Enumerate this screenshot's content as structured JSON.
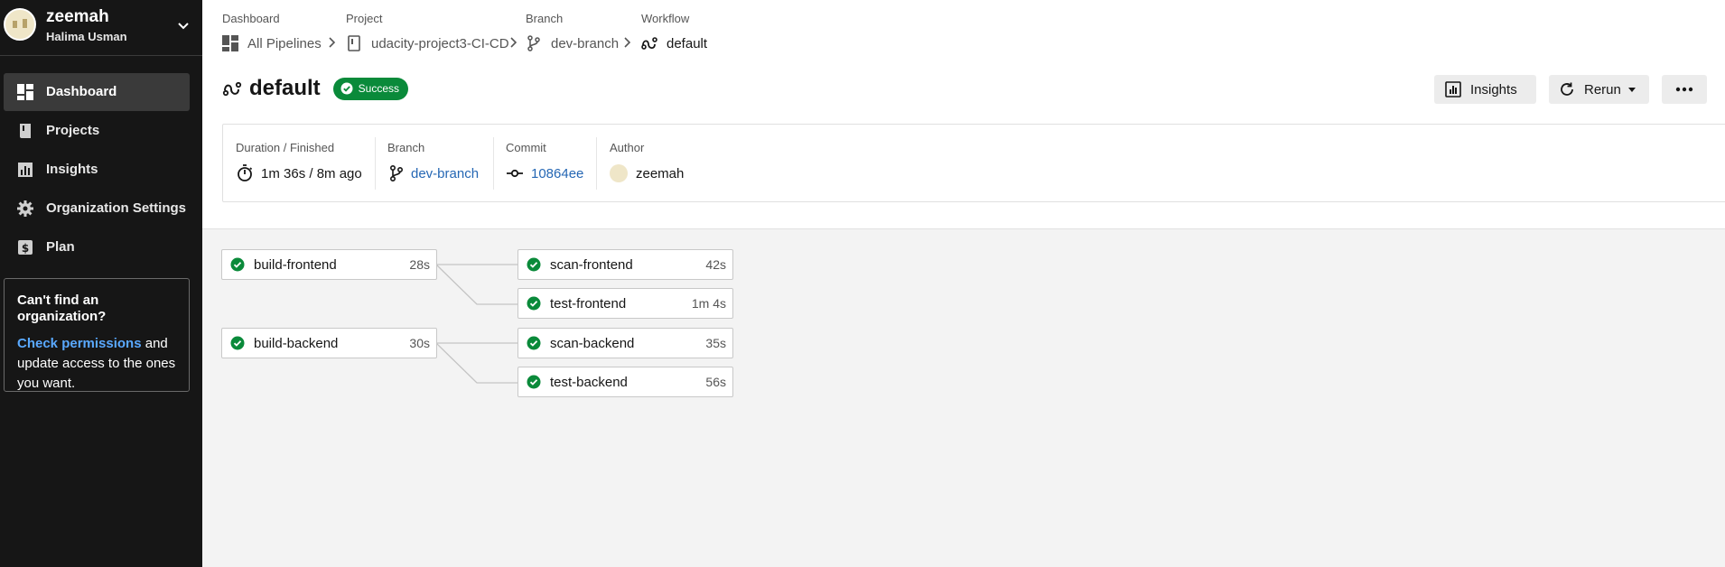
{
  "org": {
    "name": "zeemah",
    "user": "Halima Usman"
  },
  "sidebar": {
    "items": [
      {
        "label": "Dashboard",
        "icon": "dashboard-icon",
        "active": true
      },
      {
        "label": "Projects",
        "icon": "book-icon",
        "active": false
      },
      {
        "label": "Insights",
        "icon": "chart-icon",
        "active": false
      },
      {
        "label": "Organization Settings",
        "icon": "gear-icon",
        "active": false
      },
      {
        "label": "Plan",
        "icon": "dollar-icon",
        "active": false
      }
    ],
    "notice": {
      "title": "Can't find an organization?",
      "link": "Check permissions",
      "body": " and update access to the ones you want."
    }
  },
  "breadcrumb": [
    {
      "caption": "Dashboard",
      "value": "All Pipelines",
      "icon": "grid-icon"
    },
    {
      "caption": "Project",
      "value": "udacity-project3-CI-CD",
      "icon": "repo-icon"
    },
    {
      "caption": "Branch",
      "value": "dev-branch",
      "icon": "branch-icon"
    },
    {
      "caption": "Workflow",
      "value": "default",
      "icon": "workflow-icon"
    }
  ],
  "workflow": {
    "name": "default",
    "status": "Success"
  },
  "actions": {
    "insights": "Insights",
    "rerun": "Rerun"
  },
  "summary": {
    "duration_caption": "Duration / Finished",
    "duration_value": "1m 36s / 8m ago",
    "branch_caption": "Branch",
    "branch_value": "dev-branch",
    "commit_caption": "Commit",
    "commit_value": "10864ee",
    "author_caption": "Author",
    "author_value": "zeemah"
  },
  "jobs": [
    {
      "name": "build-frontend",
      "duration": "28s"
    },
    {
      "name": "scan-frontend",
      "duration": "42s"
    },
    {
      "name": "test-frontend",
      "duration": "1m 4s"
    },
    {
      "name": "build-backend",
      "duration": "30s"
    },
    {
      "name": "scan-backend",
      "duration": "35s"
    },
    {
      "name": "test-backend",
      "duration": "56s"
    }
  ],
  "colors": {
    "success": "#0a8a3a",
    "link": "#2567b4",
    "sidebar_bg": "#161616"
  }
}
